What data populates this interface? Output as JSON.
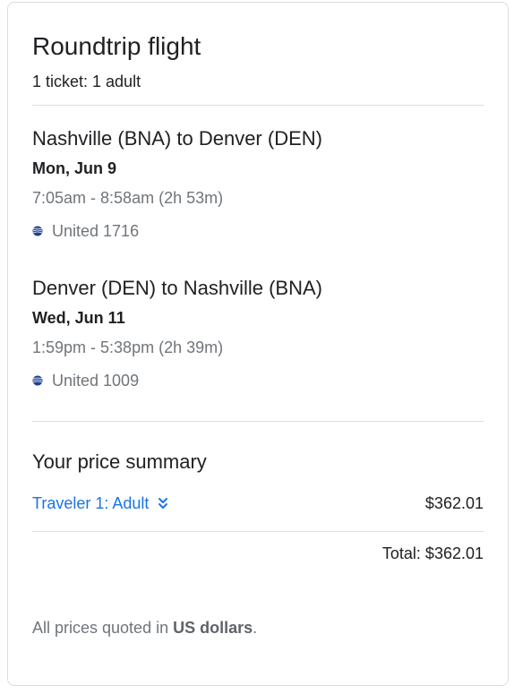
{
  "header": {
    "title": "Roundtrip flight",
    "ticket_summary": "1 ticket: 1 adult"
  },
  "flights": [
    {
      "route": "Nashville (BNA) to Denver (DEN)",
      "date": "Mon, Jun 9",
      "times": "7:05am - 8:58am (2h 53m)",
      "airline_icon": "united-airlines-logo-icon",
      "airline": "United 1716"
    },
    {
      "route": "Denver (DEN) to Nashville (BNA)",
      "date": "Wed, Jun 11",
      "times": "1:59pm - 5:38pm (2h 39m)",
      "airline_icon": "united-airlines-logo-icon",
      "airline": "United 1009"
    }
  ],
  "price_summary": {
    "title": "Your price summary",
    "traveler_label": "Traveler 1: Adult",
    "traveler_price": "$362.01",
    "total": "Total: $362.01"
  },
  "footnote": {
    "prefix": "All prices quoted in ",
    "currency": "US dollars",
    "suffix": "."
  },
  "colors": {
    "link": "#1a73e8",
    "muted_text": "#70757a",
    "primary_text": "#202124",
    "divider": "#dadce0",
    "airline_logo": "#1b3f94"
  }
}
